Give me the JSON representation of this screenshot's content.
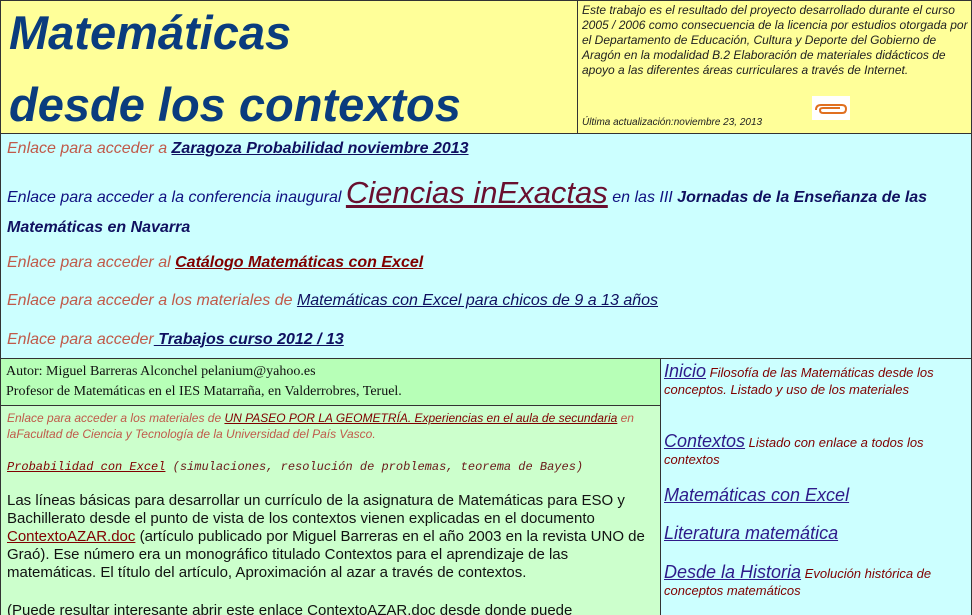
{
  "header": {
    "title_line1": "Matemáticas",
    "title_line2": "desde los contextos",
    "info": "Este trabajo es el resultado del proyecto desarrollado durante el curso 2005 / 2006 como consecuencia de la licencia por estudios otorgada por el Departamento de Educación, Cultura y Deporte del Gobierno de Aragón en la modalidad B.2 Elaboración de materiales didácticos de apoyo a las diferentes áreas curriculares a través de Internet.",
    "update": "Última actualización:noviembre 23, 2013",
    "clip_icon": "paperclip-icon"
  },
  "links": {
    "r1_prefix": "Enlace para acceder a ",
    "r1_link": "Zaragoza Probabilidad noviembre 2013",
    "conf_prefix": "Enlace para acceder a la conferencia inaugural ",
    "conf_link": "Ciencias inExactas",
    "conf_middle": " en las III ",
    "conf_bold": "Jornadas de la Enseñanza de las Matemáticas en Navarra",
    "r3_prefix": "Enlace para acceder al ",
    "r3_link": "Catálogo Matemáticas con Excel",
    "r4_prefix": "Enlace para acceder a los materiales de ",
    "r4_link": "Matemáticas con Excel para chicos de 9 a 13 años",
    "r5_prefix": "Enlace para acceder",
    "r5_link": " Trabajos curso 2012 / 13"
  },
  "author": {
    "line1": "Autor: Miguel Barreras Alconchel pelanium@yahoo.es",
    "line2": "Profesor de Matemáticas en el IES Matarraña, en Valderrobres, Teruel."
  },
  "main": {
    "geo_prefix": "Enlace para acceder a los materiales de ",
    "geo_link": "UN PASEO POR LA GEOMETRÍA. Experiencias en el aula de secundaria",
    "geo_suffix": " en laFacultad de Ciencia y Tecnología de la Universidad del País Vasco.",
    "prob_link": "Probabilidad con Excel",
    "prob_suffix": " (simulaciones, resolución de problemas, teorema de Bayes)",
    "para_a": "Las líneas básicas para desarrollar un currículo de la asignatura de Matemáticas para ESO y Bachillerato desde el punto de vista de los contextos vienen explicadas en el documento ",
    "para_link": "ContextoAZAR.doc",
    "para_b": " (artículo publicado por Miguel Barreras en el año 2003 en la revista UNO de Graó). Ese número era un monográfico titulado Contextos para el aprendizaje de las matemáticas. El título del artículo, Aproximación al azar a través de contextos.",
    "para2": "(Puede resultar interesante abrir este enlace ContextoAZAR.doc desde donde puede"
  },
  "side": {
    "items": [
      {
        "link": "Inicio",
        "desc": " Filosofía de las Matemáticas desde los conceptos. Listado y uso de los materiales"
      },
      {
        "link": "Contextos",
        "desc": " Listado con enlace a todos los contextos"
      },
      {
        "link": "Matemáticas con Excel",
        "desc": ""
      },
      {
        "link": "Literatura matemática",
        "desc": ""
      },
      {
        "link": "Desde la Historia",
        "desc": " Evolución histórica de conceptos matemáticos"
      }
    ]
  }
}
